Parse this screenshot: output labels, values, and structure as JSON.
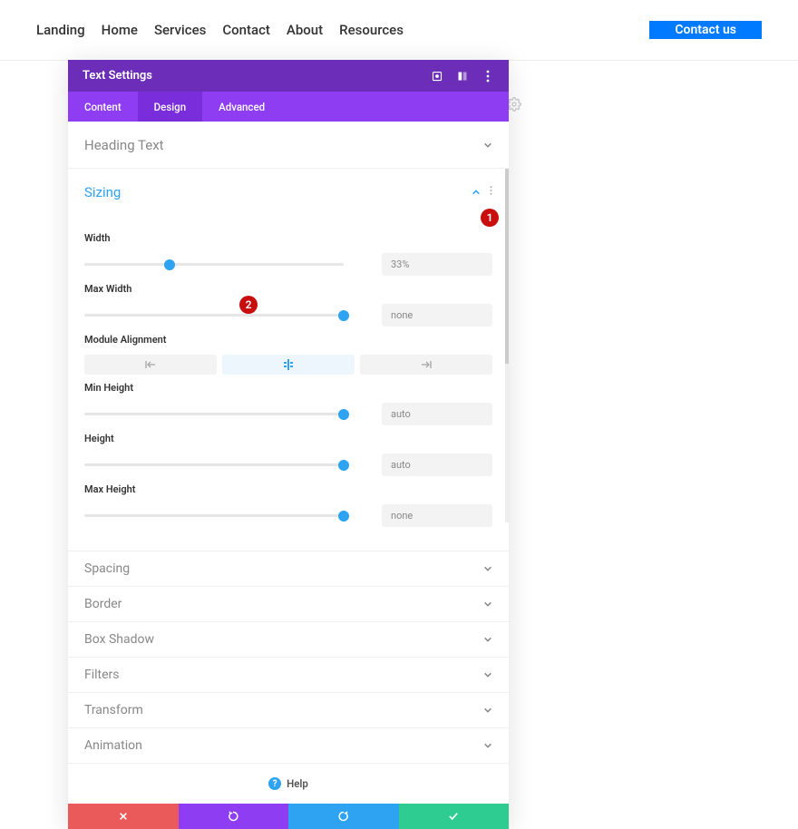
{
  "nav": {
    "items": [
      "Landing",
      "Home",
      "Services",
      "Contact",
      "About",
      "Resources"
    ],
    "contact_label": "Contact us"
  },
  "panel": {
    "title": "Text Settings",
    "tabs": [
      "Content",
      "Design",
      "Advanced"
    ],
    "active_tab_index": 1
  },
  "sections": {
    "heading_text": "Heading Text",
    "sizing": "Sizing",
    "spacing": "Spacing",
    "border": "Border",
    "box_shadow": "Box Shadow",
    "filters": "Filters",
    "transform": "Transform",
    "animation": "Animation"
  },
  "sizing": {
    "width": {
      "label": "Width",
      "value": "33%",
      "slider_pct": 33
    },
    "max_width": {
      "label": "Max Width",
      "value": "none",
      "slider_pct": 100
    },
    "module_alignment": {
      "label": "Module Alignment",
      "active": "center"
    },
    "min_height": {
      "label": "Min Height",
      "value": "auto",
      "slider_pct": 100
    },
    "height": {
      "label": "Height",
      "value": "auto",
      "slider_pct": 100
    },
    "max_height": {
      "label": "Max Height",
      "value": "none",
      "slider_pct": 100
    }
  },
  "help_label": "Help",
  "callouts": {
    "one": "1",
    "two": "2"
  }
}
